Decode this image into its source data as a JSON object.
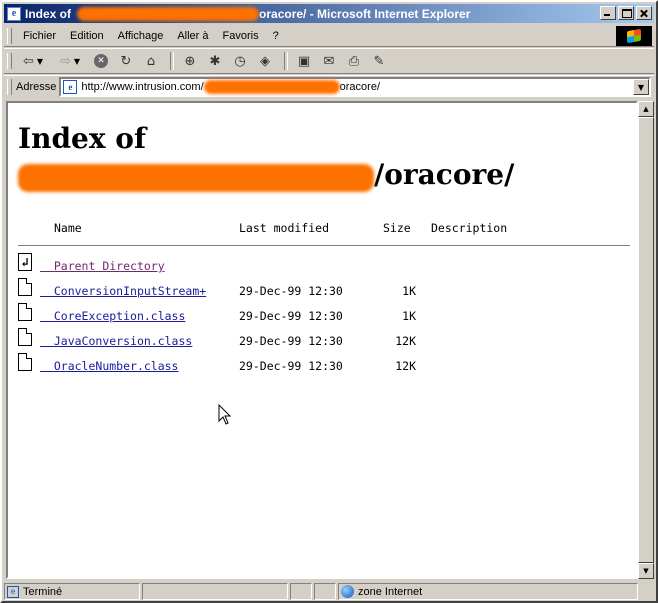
{
  "window": {
    "title_visible_prefix": "Index of",
    "title_visible_suffix": "oracore/ - Microsoft Internet Explorer"
  },
  "menu": {
    "items": [
      "Fichier",
      "Edition",
      "Affichage",
      "Aller à",
      "Favoris",
      "?"
    ]
  },
  "toolbar": {
    "icons": [
      "back-icon",
      "forward-icon",
      "stop-icon",
      "refresh-icon",
      "home-icon",
      "search-icon",
      "favorites-icon",
      "history-icon",
      "channels-icon",
      "fullscreen-icon",
      "mail-icon",
      "print-icon",
      "edit-icon"
    ]
  },
  "address": {
    "label": "Adresse",
    "url_prefix": "http://www.intrusion.com/",
    "url_suffix": "oracore/"
  },
  "page": {
    "heading_line1": "Index of",
    "heading_line2_visible": "/oracore/",
    "columns": {
      "name": "Name",
      "last_modified": "Last modified",
      "size": "Size",
      "description": "Description"
    },
    "parent_link": "Parent Directory",
    "files": [
      {
        "name": "ConversionInputStream+",
        "modified": "29-Dec-99 12:30",
        "size": "1K"
      },
      {
        "name": "CoreException.class",
        "modified": "29-Dec-99 12:30",
        "size": "1K"
      },
      {
        "name": "JavaConversion.class",
        "modified": "29-Dec-99 12:30",
        "size": "12K"
      },
      {
        "name": "OracleNumber.class",
        "modified": "29-Dec-99 12:30",
        "size": "12K"
      }
    ]
  },
  "status": {
    "left_text": "Terminé",
    "zone_text": "zone Internet"
  },
  "colors": {
    "redaction": "#fd7100",
    "titlebar_start": "#0a246a",
    "titlebar_end": "#a6caf0",
    "link": "#1a1a9a",
    "visited_link": "#6e2a6e"
  }
}
